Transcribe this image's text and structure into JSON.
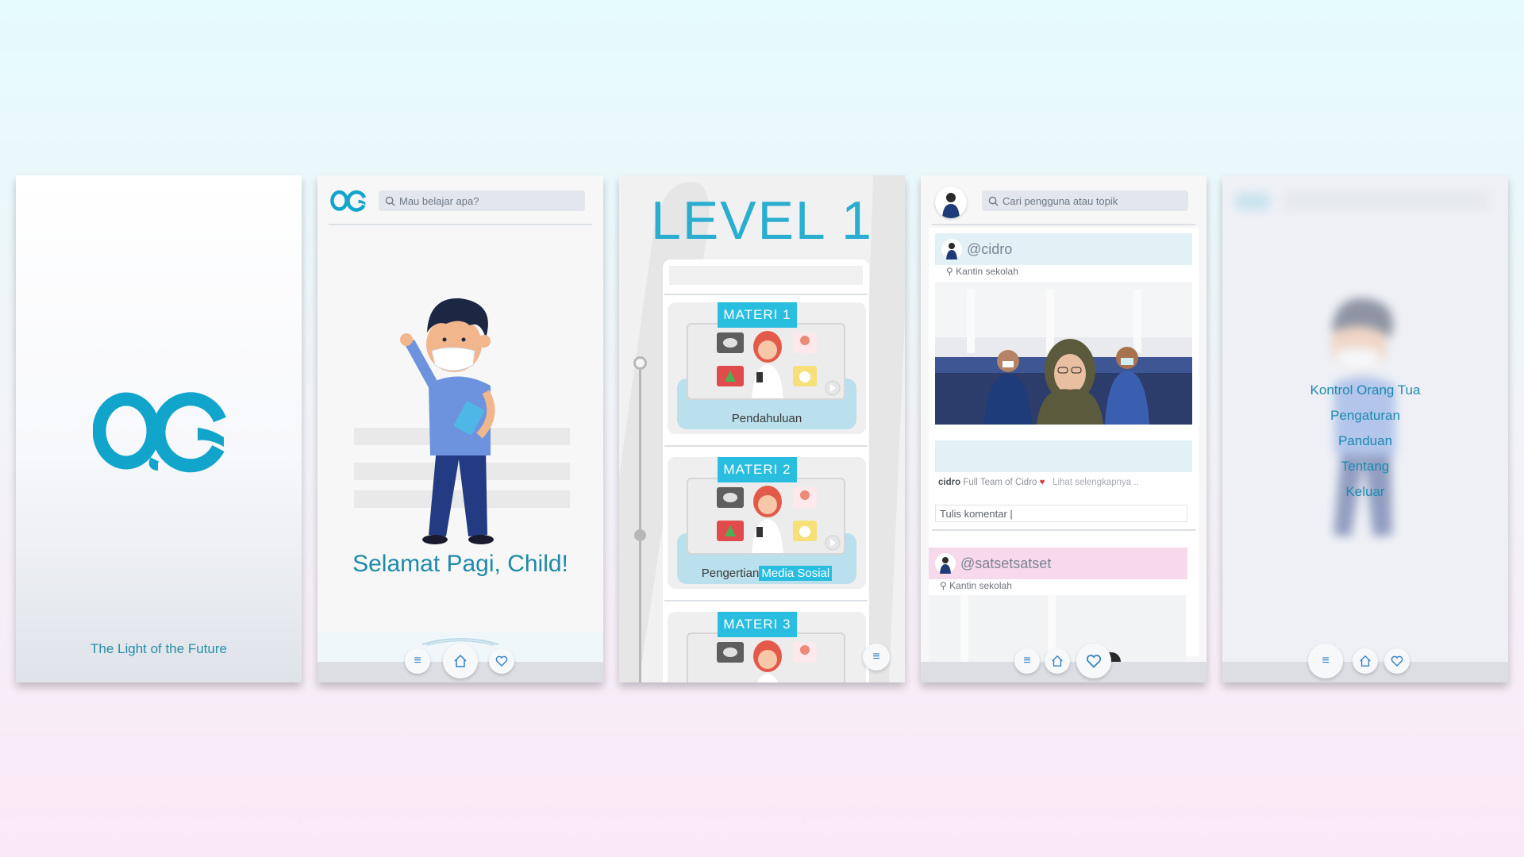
{
  "colors": {
    "brand": "#29aed0",
    "accent": "#1b8ab0",
    "tag": "#29bde0"
  },
  "splash": {
    "logo_text": "OC",
    "tagline": "The Light of the Future"
  },
  "home": {
    "logo_text": "OC",
    "search_placeholder": "Mau belajar apa?",
    "greeting": "Selamat Pagi, Child!",
    "nav": [
      "menu-icon",
      "home-icon",
      "heart-icon"
    ]
  },
  "level": {
    "title": "LEVEL 1",
    "materi": [
      {
        "tag": "MATERI 1",
        "title": "Pendahuluan",
        "highlight": ""
      },
      {
        "tag": "MATERI 2",
        "title": "Pengertian",
        "highlight": "Media Sosial"
      },
      {
        "tag": "MATERI 3",
        "title": "",
        "highlight": ""
      }
    ]
  },
  "feed": {
    "search_placeholder": "Cari pengguna atau topik",
    "posts": [
      {
        "username": "@cidro",
        "location": "Kantin sekolah",
        "caption_user": "cidro",
        "caption_text": "Full Team of Cidro",
        "more": "Lihat selengkapnya ..",
        "comment_placeholder": "Tulis komentar |"
      },
      {
        "username": "@satsetsatset",
        "location": "Kantin sekolah"
      }
    ]
  },
  "menu": {
    "items": [
      "Kontrol Orang Tua",
      "Pengaturan",
      "Panduan",
      "Tentang",
      "Keluar"
    ]
  }
}
